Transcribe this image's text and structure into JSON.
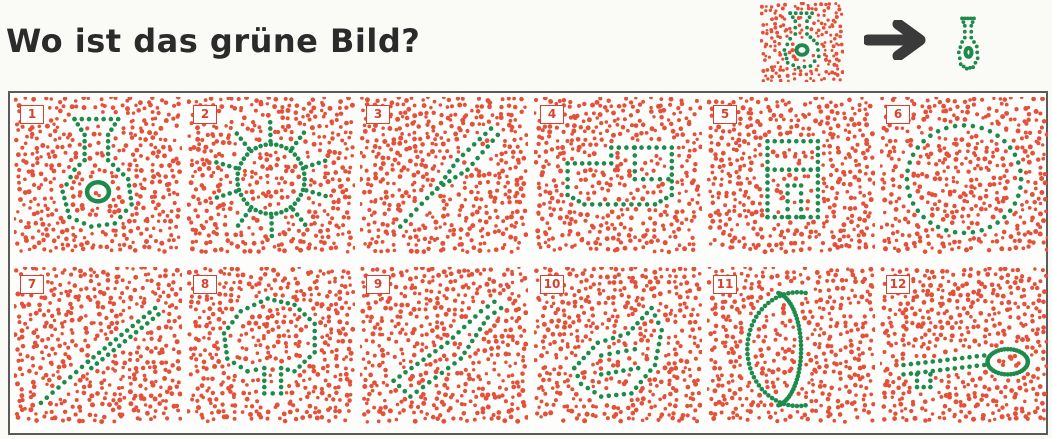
{
  "title": "Wo ist das grüne Bild?",
  "colors": {
    "red": "#e4513a",
    "green": "#1e8a4c",
    "title": "#2b2b2b",
    "frame": "#5a5a5a",
    "arrow": "#3a3a3a"
  },
  "example": {
    "tile_icon": "vase-dots-icon",
    "arrow_icon": "arrow-right-icon",
    "result_icon": "vase-outline-icon"
  },
  "tiles": [
    {
      "number": "1",
      "shape": "vase"
    },
    {
      "number": "2",
      "shape": "sun"
    },
    {
      "number": "3",
      "shape": "spoon"
    },
    {
      "number": "4",
      "shape": "locomotive"
    },
    {
      "number": "5",
      "shape": "house"
    },
    {
      "number": "6",
      "shape": "circle"
    },
    {
      "number": "7",
      "shape": "knife"
    },
    {
      "number": "8",
      "shape": "tree"
    },
    {
      "number": "9",
      "shape": "bottle"
    },
    {
      "number": "10",
      "shape": "fish"
    },
    {
      "number": "11",
      "shape": "moon"
    },
    {
      "number": "12",
      "shape": "key"
    }
  ]
}
